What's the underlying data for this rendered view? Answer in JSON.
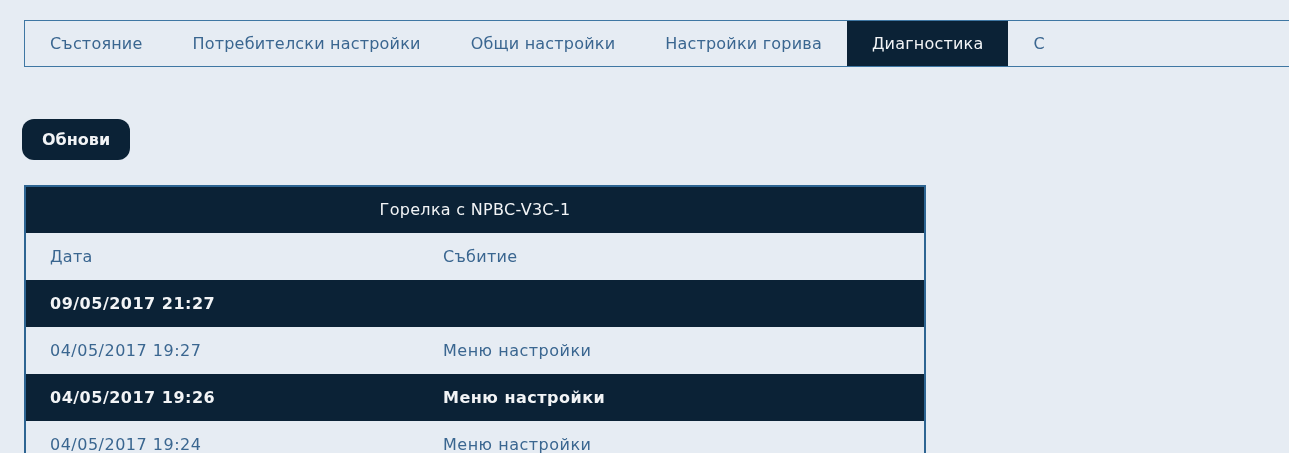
{
  "tabs": [
    {
      "label": "Състояние",
      "selected": false
    },
    {
      "label": "Потребителски настройки",
      "selected": false
    },
    {
      "label": "Общи настройки",
      "selected": false
    },
    {
      "label": "Настройки горива",
      "selected": false
    },
    {
      "label": "Диагностика",
      "selected": true
    },
    {
      "label": "С",
      "selected": false
    }
  ],
  "refresh_button": "Обнови",
  "table": {
    "title": "Горелка с NPBC-V3C-1",
    "columns": [
      "Дата",
      "Събитие"
    ],
    "rows": [
      {
        "date": "09/05/2017 21:27"
      },
      {
        "date": "04/05/2017 19:27",
        "event": "Меню настройки"
      },
      {
        "date": "04/05/2017 19:26",
        "event": "Меню настройки"
      },
      {
        "date": "04/05/2017 19:24",
        "event": "Меню настройки"
      }
    ]
  }
}
